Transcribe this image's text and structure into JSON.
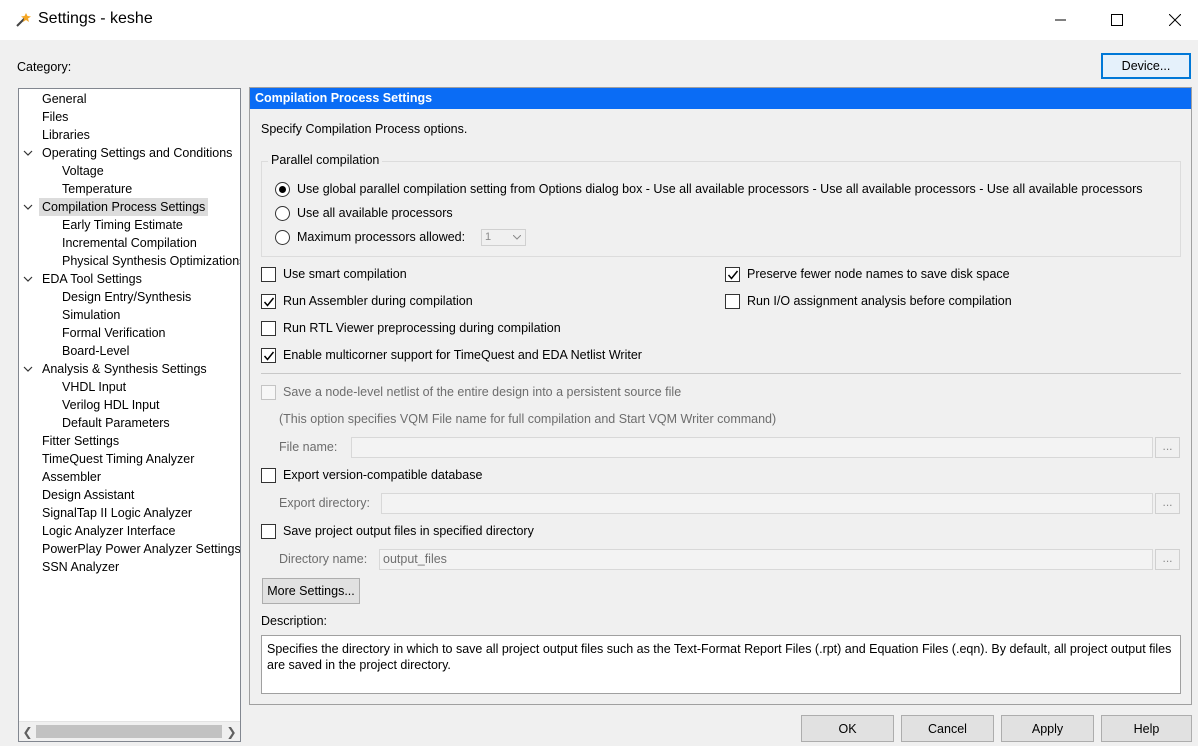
{
  "window": {
    "title": "Settings - keshe",
    "minimize_icon": "minimize-icon",
    "maximize_icon": "maximize-icon",
    "close_icon": "close-icon"
  },
  "category_label": "Category:",
  "device_button": "Device...",
  "tree": [
    {
      "label": "General",
      "level": 0
    },
    {
      "label": "Files",
      "level": 0
    },
    {
      "label": "Libraries",
      "level": 0
    },
    {
      "label": "Operating Settings and Conditions",
      "level": 0,
      "expanded": true
    },
    {
      "label": "Voltage",
      "level": 1
    },
    {
      "label": "Temperature",
      "level": 1
    },
    {
      "label": "Compilation Process Settings",
      "level": 0,
      "expanded": true,
      "selected": true
    },
    {
      "label": "Early Timing Estimate",
      "level": 1
    },
    {
      "label": "Incremental Compilation",
      "level": 1
    },
    {
      "label": "Physical Synthesis Optimizations",
      "level": 1
    },
    {
      "label": "EDA Tool Settings",
      "level": 0,
      "expanded": true
    },
    {
      "label": "Design Entry/Synthesis",
      "level": 1
    },
    {
      "label": "Simulation",
      "level": 1
    },
    {
      "label": "Formal Verification",
      "level": 1
    },
    {
      "label": "Board-Level",
      "level": 1
    },
    {
      "label": "Analysis & Synthesis Settings",
      "level": 0,
      "expanded": true
    },
    {
      "label": "VHDL Input",
      "level": 1
    },
    {
      "label": "Verilog HDL Input",
      "level": 1
    },
    {
      "label": "Default Parameters",
      "level": 1
    },
    {
      "label": "Fitter Settings",
      "level": 0
    },
    {
      "label": "TimeQuest Timing Analyzer",
      "level": 0
    },
    {
      "label": "Assembler",
      "level": 0
    },
    {
      "label": "Design Assistant",
      "level": 0
    },
    {
      "label": "SignalTap II Logic Analyzer",
      "level": 0
    },
    {
      "label": "Logic Analyzer Interface",
      "level": 0
    },
    {
      "label": "PowerPlay Power Analyzer Settings",
      "level": 0
    },
    {
      "label": "SSN Analyzer",
      "level": 0
    }
  ],
  "panel": {
    "header": "Compilation Process Settings",
    "intro": "Specify Compilation Process options.",
    "parallel": {
      "title": "Parallel compilation",
      "option_global": "Use global parallel compilation setting from Options dialog box - Use all available processors - Use all available processors - Use all available processors",
      "option_all": "Use all available processors",
      "option_max": "Maximum processors allowed:",
      "max_value": "1",
      "selected": "global"
    },
    "checks": {
      "smart": {
        "label": "Use smart compilation",
        "checked": false
      },
      "assembler": {
        "label": "Run Assembler during compilation",
        "checked": true
      },
      "rtl": {
        "label": "Run RTL Viewer preprocessing during compilation",
        "checked": false
      },
      "multicorner": {
        "label": "Enable multicorner support for TimeQuest and EDA Netlist Writer",
        "checked": true
      },
      "preserve": {
        "label": "Preserve fewer node names to save disk space",
        "checked": true
      },
      "io": {
        "label": "Run I/O assignment analysis before compilation",
        "checked": false
      }
    },
    "netlist": {
      "label": "Save a node-level netlist of the entire design into a persistent source file",
      "note": "(This option specifies VQM File name for full compilation and Start VQM Writer command)",
      "file_label": "File name:",
      "file_value": ""
    },
    "export": {
      "label": "Export version-compatible database",
      "dir_label": "Export directory:",
      "dir_value": ""
    },
    "save_output": {
      "label": "Save project output files in specified directory",
      "dir_label": "Directory name:",
      "dir_value": "output_files"
    },
    "browse": "...",
    "more_settings": "More Settings...",
    "description_label": "Description:",
    "description": "Specifies the directory in which to save all project output files such as the Text-Format Report Files (.rpt) and Equation Files (.eqn). By default, all project output files are saved in the project directory."
  },
  "footer": {
    "ok": "OK",
    "cancel": "Cancel",
    "apply": "Apply",
    "help": "Help"
  }
}
